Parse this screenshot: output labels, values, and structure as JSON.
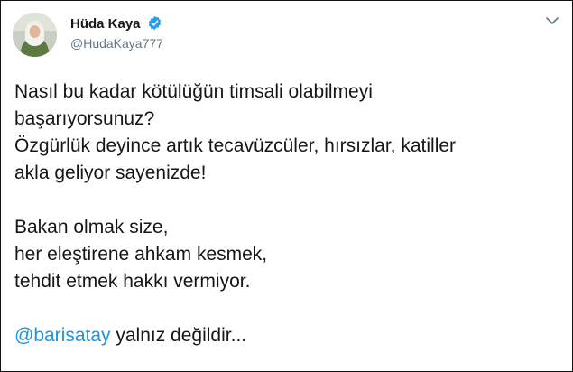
{
  "author": {
    "name": "Hüda Kaya",
    "handle": "@HudaKaya777",
    "verified": true
  },
  "tweet": {
    "paragraph1": [
      "Nasıl bu kadar kötülüğün timsali olabilmeyi",
      "başarıyorsunuz?",
      "Özgürlük deyince artık tecavüzcüler, hırsızlar, katiller",
      "akla geliyor sayenizde!"
    ],
    "paragraph2": [
      "Bakan olmak size,",
      "her eleştirene ahkam kesmek,",
      "tehdit etmek hakkı vermiyor."
    ],
    "mention": "@barisatay",
    "closing": " yalnız değildir..."
  },
  "icons": {
    "verified": "verified-badge-icon",
    "more": "chevron-down-icon"
  },
  "colors": {
    "text": "#14171a",
    "secondary": "#657786",
    "link": "#1b95e0",
    "verified": "#1da1f2",
    "border": "#111111"
  }
}
